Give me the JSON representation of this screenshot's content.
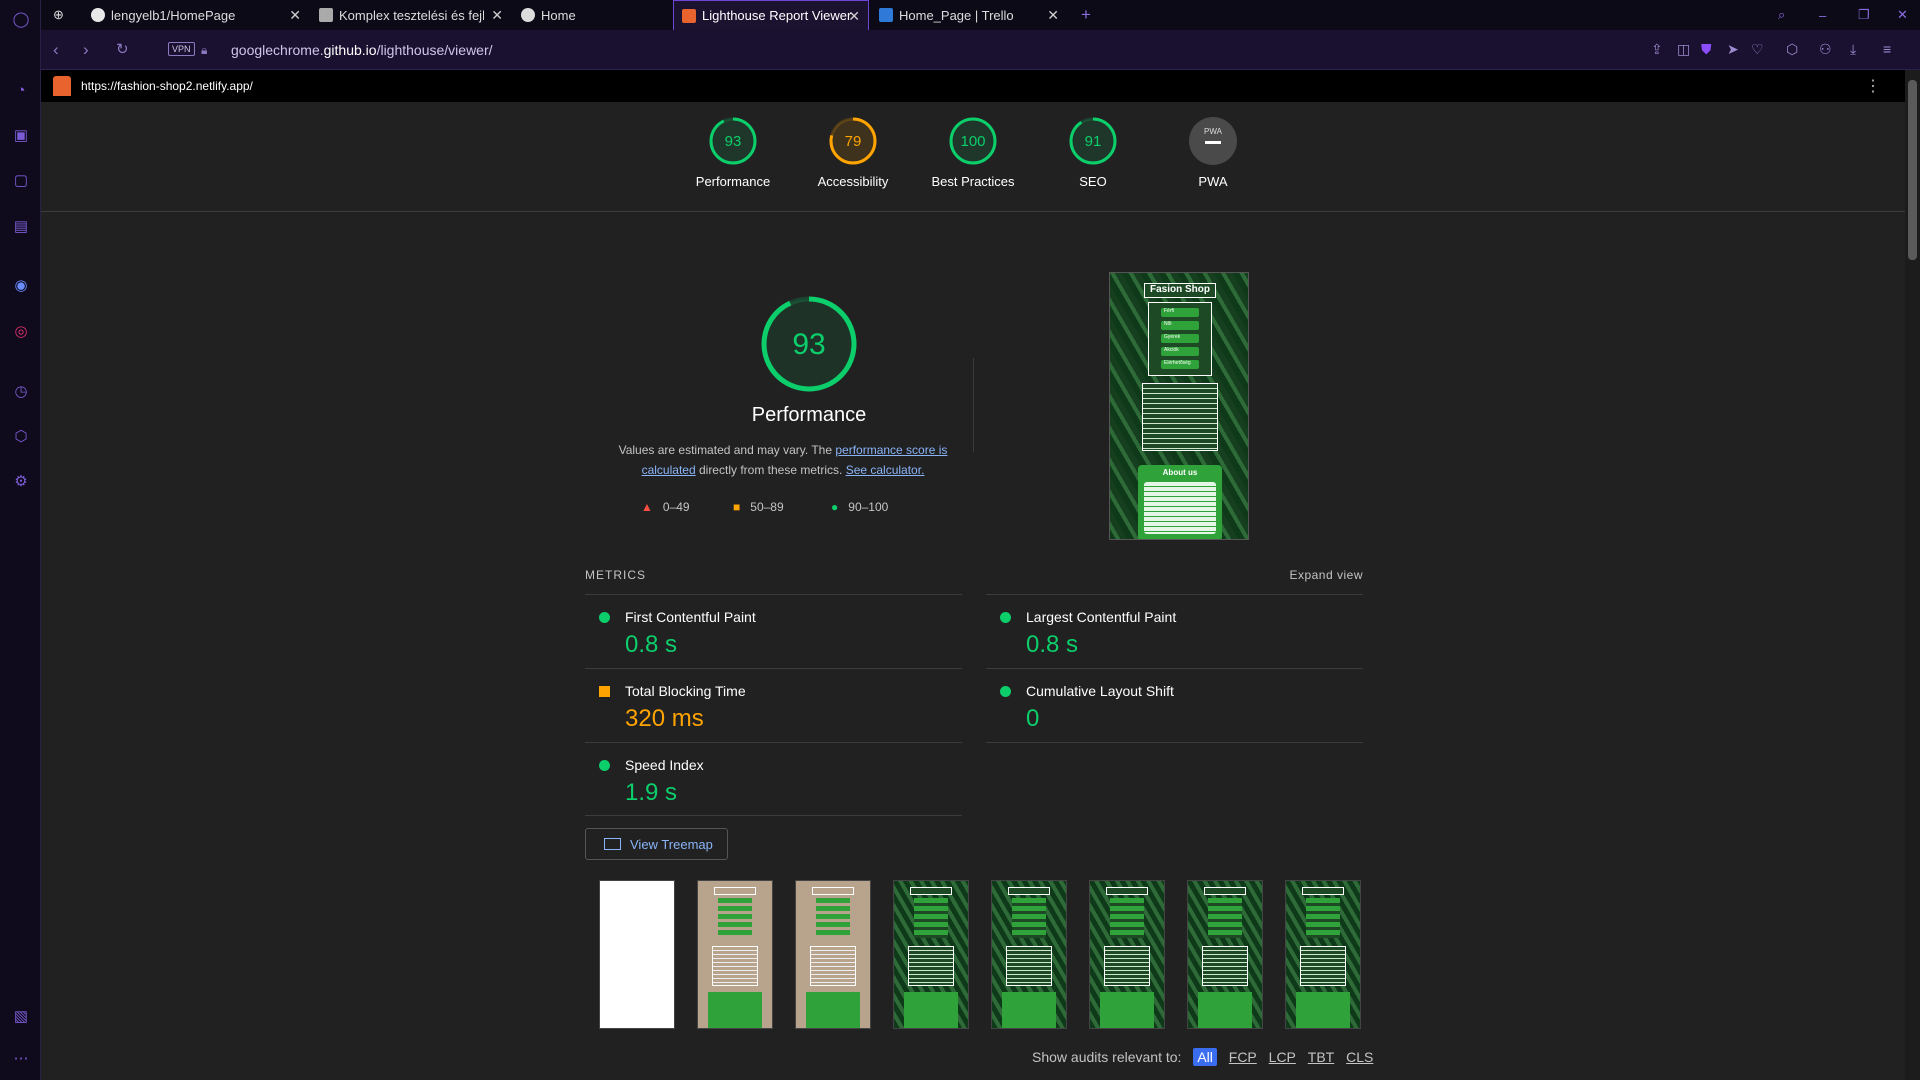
{
  "browser": {
    "tabs": [
      {
        "title": "lengyelb1/HomePage",
        "color": "#e8e8e8"
      },
      {
        "title": "Komplex tesztelési és fejle",
        "color": "#aaa"
      },
      {
        "title": "Home",
        "color": "#dcdcdc"
      },
      {
        "title": "Lighthouse Report Viewer",
        "color": "#e8632e",
        "active": true
      },
      {
        "title": "Home_Page | Trello",
        "color": "#2f7ad8"
      }
    ],
    "new_tab": "+",
    "vpn_label": "VPN",
    "url_prefix": "googlechrome.",
    "url_host": "github.io",
    "url_path": "/lighthouse/viewer/"
  },
  "report": {
    "page_url": "https://fashion-shop2.netlify.app/",
    "categories": [
      {
        "score": "93",
        "label": "Performance",
        "color": "#0cce6b",
        "value": 0.93
      },
      {
        "score": "79",
        "label": "Accessibility",
        "color": "#ffa400",
        "value": 0.79
      },
      {
        "score": "100",
        "label": "Best Practices",
        "color": "#0cce6b",
        "value": 1.0
      },
      {
        "score": "91",
        "label": "SEO",
        "color": "#0cce6b",
        "value": 0.91
      },
      {
        "score": "PWA",
        "label": "PWA",
        "color": "#9e9e9e",
        "value": 0
      }
    ],
    "main_score": "93",
    "main_title": "Performance",
    "desc_prefix": "Values are estimated and may vary. The ",
    "desc_link1": "performance score is calculated",
    "desc_mid": " directly from these metrics. ",
    "desc_link2": "See calculator.",
    "legend": [
      "0–49",
      "50–89",
      "90–100"
    ],
    "metrics_label": "METRICS",
    "expand_label": "Expand view",
    "metrics": [
      {
        "name": "First Contentful Paint",
        "value": "0.8 s",
        "status": "pass"
      },
      {
        "name": "Largest Contentful Paint",
        "value": "0.8 s",
        "status": "pass"
      },
      {
        "name": "Total Blocking Time",
        "value": "320 ms",
        "status": "average"
      },
      {
        "name": "Cumulative Layout Shift",
        "value": "0",
        "status": "pass"
      },
      {
        "name": "Speed Index",
        "value": "1.9 s",
        "status": "pass"
      }
    ],
    "treemap_label": "View Treemap",
    "audits_label": "Show audits relevant to:",
    "audit_filters": [
      "All",
      "FCP",
      "LCP",
      "TBT",
      "CLS"
    ],
    "screenshot": {
      "site_title": "Fasion Shop",
      "menu": [
        "Férfi",
        "Női",
        "Gyerek",
        "Akciók",
        "Elérhetőség"
      ],
      "about": "About us"
    }
  },
  "colors": {
    "pass": "#0cce6b",
    "average": "#ffa400",
    "fail": "#ff4e42",
    "link": "#8ab4f8"
  }
}
